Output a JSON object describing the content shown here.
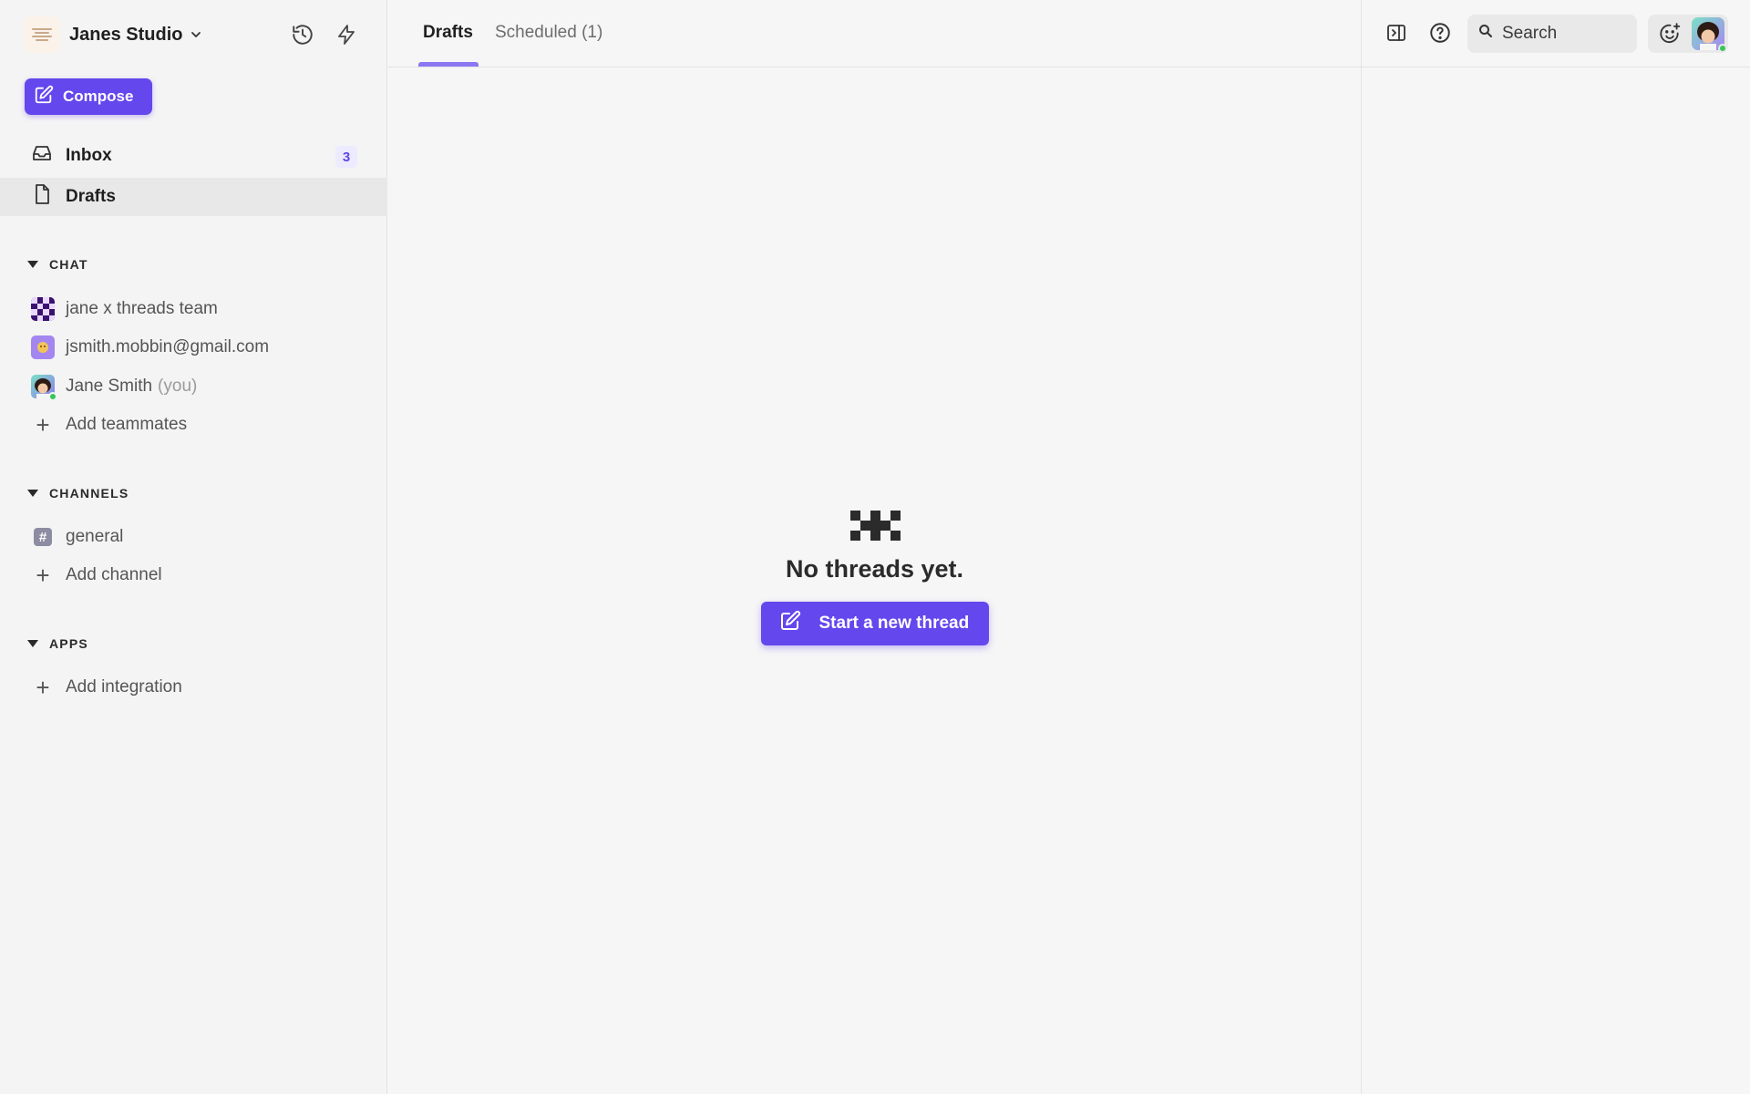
{
  "workspace": {
    "name": "Janes Studio"
  },
  "sidebar": {
    "compose_label": "Compose",
    "nav": [
      {
        "label": "Inbox",
        "badge": "3"
      },
      {
        "label": "Drafts"
      }
    ],
    "sections": {
      "chat": {
        "title": "CHAT",
        "items": [
          {
            "label": "jane x threads team"
          },
          {
            "label": "jsmith.mobbin@gmail.com"
          },
          {
            "label": "Jane Smith",
            "suffix": "(you)"
          }
        ],
        "add_label": "Add teammates"
      },
      "channels": {
        "title": "CHANNELS",
        "items": [
          {
            "label": "general"
          }
        ],
        "add_label": "Add channel"
      },
      "apps": {
        "title": "APPS",
        "add_label": "Add integration"
      }
    }
  },
  "main": {
    "tabs": [
      {
        "label": "Drafts"
      },
      {
        "label": "Scheduled (1)"
      }
    ],
    "empty_state": {
      "title": "No threads yet.",
      "button_label": "Start a new thread"
    }
  },
  "header": {
    "search_placeholder": "Search"
  },
  "colors": {
    "accent": "#6447ed",
    "badge_bg": "#ecebff",
    "online": "#34c759"
  },
  "icons": {
    "history": "history-icon",
    "bolt": "bolt-icon",
    "compose": "edit-icon",
    "inbox": "inbox-icon",
    "drafts": "file-icon",
    "sidebar_toggle": "panel-toggle-icon",
    "help": "help-icon",
    "search": "search-icon",
    "emoji": "add-reaction-icon"
  }
}
